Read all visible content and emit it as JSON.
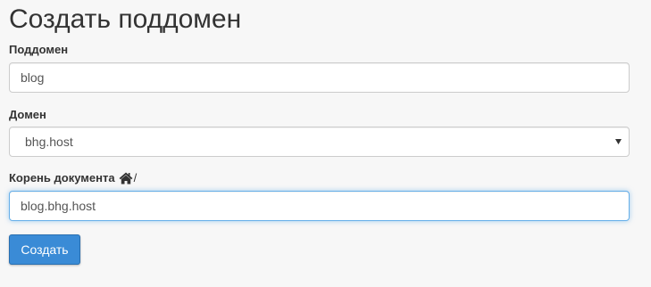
{
  "page": {
    "title": "Создать поддомен"
  },
  "form": {
    "subdomain": {
      "label": "Поддомен",
      "value": "blog"
    },
    "domain": {
      "label": "Домен",
      "selected": "bhg.host",
      "icon": "caret-down-icon"
    },
    "document_root": {
      "label": "Корень документа",
      "icon": "home-icon",
      "path_suffix": "/",
      "value": "blog.bhg.host"
    },
    "submit": {
      "label": "Создать",
      "color": "#3a8bd6"
    }
  },
  "colors": {
    "background": "#f7f7f7",
    "focus_border": "#66afe9",
    "text": "#333333"
  }
}
